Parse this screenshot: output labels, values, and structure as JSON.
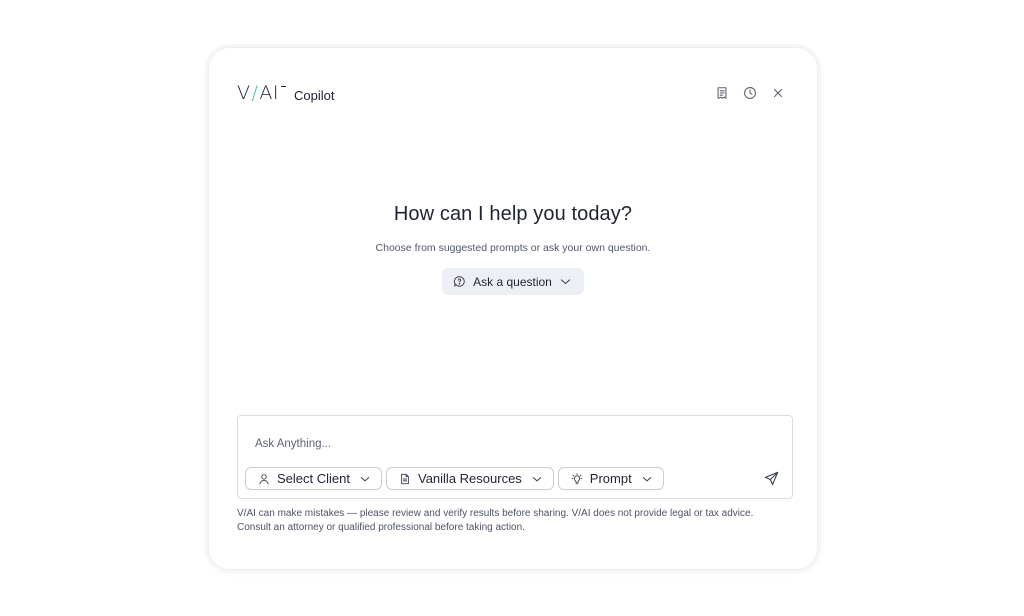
{
  "brand": {
    "logo_text_left": "V",
    "logo_slash": "/",
    "logo_text_right": "AI",
    "product": "Copilot"
  },
  "header_icons": [
    "notes-icon",
    "history-icon",
    "close-icon"
  ],
  "hero": {
    "title": "How can I help you today?",
    "subtitle": "Choose from suggested prompts or ask your own question.",
    "ask_button": "Ask a question"
  },
  "composer": {
    "placeholder": "Ask Anything...",
    "value": "",
    "chips": {
      "client": "Select Client",
      "resources": "Vanilla Resources",
      "prompt": "Prompt"
    }
  },
  "disclaimer": {
    "line1": "V/AI can make mistakes — please review and verify results before sharing. V/AI does not provide legal or tax advice.",
    "line2": "Consult an attorney or qualified professional before taking action."
  },
  "colors": {
    "accent": "#3fb7a0",
    "pill_bg": "#eceff4",
    "text": "#1f2433",
    "border": "#d9dce3"
  }
}
